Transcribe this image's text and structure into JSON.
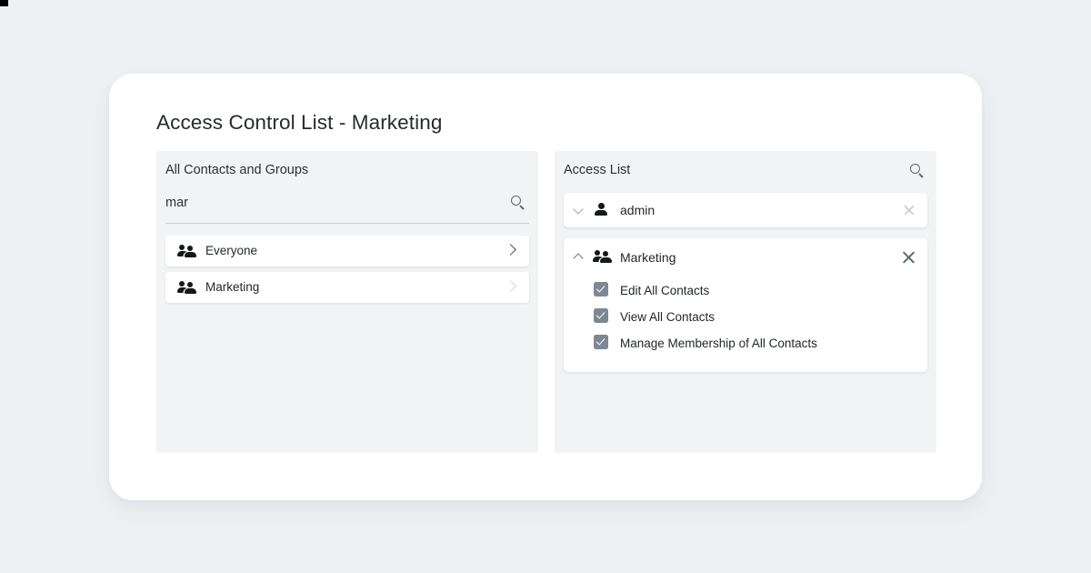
{
  "colors": {
    "page_background": "#eef0f3",
    "card_background": "#ffffff",
    "panel_background": "#f2f3f5",
    "checkbox_fill": "#7d8894",
    "text_primary": "#23272b",
    "icon_dark": "#15181b",
    "icon_muted": "#cdd1d6"
  },
  "header": {
    "title": "Access Control List - Marketing"
  },
  "left_panel": {
    "title": "All Contacts and Groups",
    "search": {
      "value": "mar",
      "placeholder": "Search",
      "icon": "search-icon"
    },
    "results": [
      {
        "label": "Everyone",
        "icon": "group-icon",
        "chevron": "chevron-right-icon",
        "chevron_state": "active"
      },
      {
        "label": "Marketing",
        "icon": "group-icon",
        "chevron": "chevron-right-icon",
        "chevron_state": "muted"
      }
    ]
  },
  "right_panel": {
    "title": "Access List",
    "search_icon": "search-icon",
    "entries": [
      {
        "name": "admin",
        "icon": "person-icon",
        "caret": "chevron-down-icon",
        "expanded": false,
        "remove_icon": "close-icon",
        "permissions": []
      },
      {
        "name": "Marketing",
        "icon": "group-icon",
        "caret": "chevron-up-icon",
        "expanded": true,
        "remove_icon": "close-icon",
        "permissions": [
          {
            "label": "Edit All Contacts",
            "checked": true
          },
          {
            "label": "View All Contacts",
            "checked": true
          },
          {
            "label": "Manage Membership of All Contacts",
            "checked": true
          }
        ]
      }
    ]
  }
}
